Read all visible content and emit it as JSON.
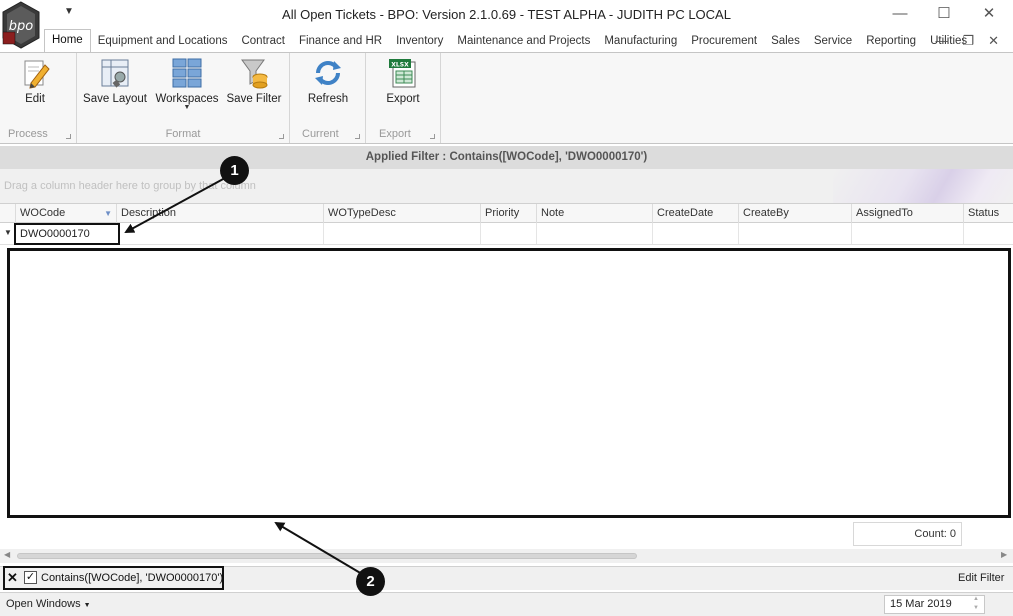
{
  "window": {
    "title": "All Open Tickets - BPO: Version 2.1.0.69 - TEST ALPHA - JUDITH PC LOCAL",
    "logo_text": "bpo",
    "minimize": "—",
    "maximize": "☐",
    "close": "✕",
    "qat_caret": "▼"
  },
  "tabs": [
    {
      "label": "Home",
      "active": true
    },
    {
      "label": "Equipment and Locations"
    },
    {
      "label": "Contract"
    },
    {
      "label": "Finance and HR"
    },
    {
      "label": "Inventory"
    },
    {
      "label": "Maintenance and Projects"
    },
    {
      "label": "Manufacturing"
    },
    {
      "label": "Procurement"
    },
    {
      "label": "Sales"
    },
    {
      "label": "Service"
    },
    {
      "label": "Reporting"
    },
    {
      "label": "Utilities"
    }
  ],
  "mdi": {
    "minimize": "—",
    "restore": "❐",
    "close": "✕"
  },
  "ribbon": {
    "groups": [
      {
        "label": "Process",
        "buttons": [
          {
            "label": "Edit",
            "icon": "edit-pencil-icon"
          }
        ]
      },
      {
        "label": "Format",
        "buttons": [
          {
            "label": "Save Layout",
            "icon": "save-layout-icon"
          },
          {
            "label": "Workspaces",
            "icon": "workspaces-grid-icon"
          },
          {
            "label": "Save Filter",
            "icon": "save-filter-icon"
          }
        ]
      },
      {
        "label": "Current",
        "buttons": [
          {
            "label": "Refresh",
            "icon": "refresh-icon"
          }
        ]
      },
      {
        "label": "Export",
        "buttons": [
          {
            "label": "Export",
            "icon": "xlsx-export-icon"
          }
        ]
      }
    ],
    "xlsx_text": "XLSX"
  },
  "applied_filter": "Applied Filter : Contains([WOCode], 'DWO0000170')",
  "group_hint": "Drag a column header here to group by that column",
  "columns": [
    "WOCode",
    "Description",
    "WOTypeDesc",
    "Priority",
    "Note",
    "CreateDate",
    "CreateBy",
    "AssignedTo",
    "Status"
  ],
  "filter_row": {
    "wocode": "DWO0000170"
  },
  "count": "Count: 0",
  "filter_footer": {
    "close": "✕",
    "checked": true,
    "expression": "Contains([WOCode], 'DWO0000170')",
    "edit": "Edit Filter"
  },
  "status": {
    "open_windows": "Open Windows",
    "date": "15 Mar 2019"
  },
  "callouts": [
    "1",
    "2"
  ],
  "colors": {
    "accent": "#2b6cb0",
    "callout": "#111111",
    "ribbon_bg": "#f7f7f7"
  }
}
